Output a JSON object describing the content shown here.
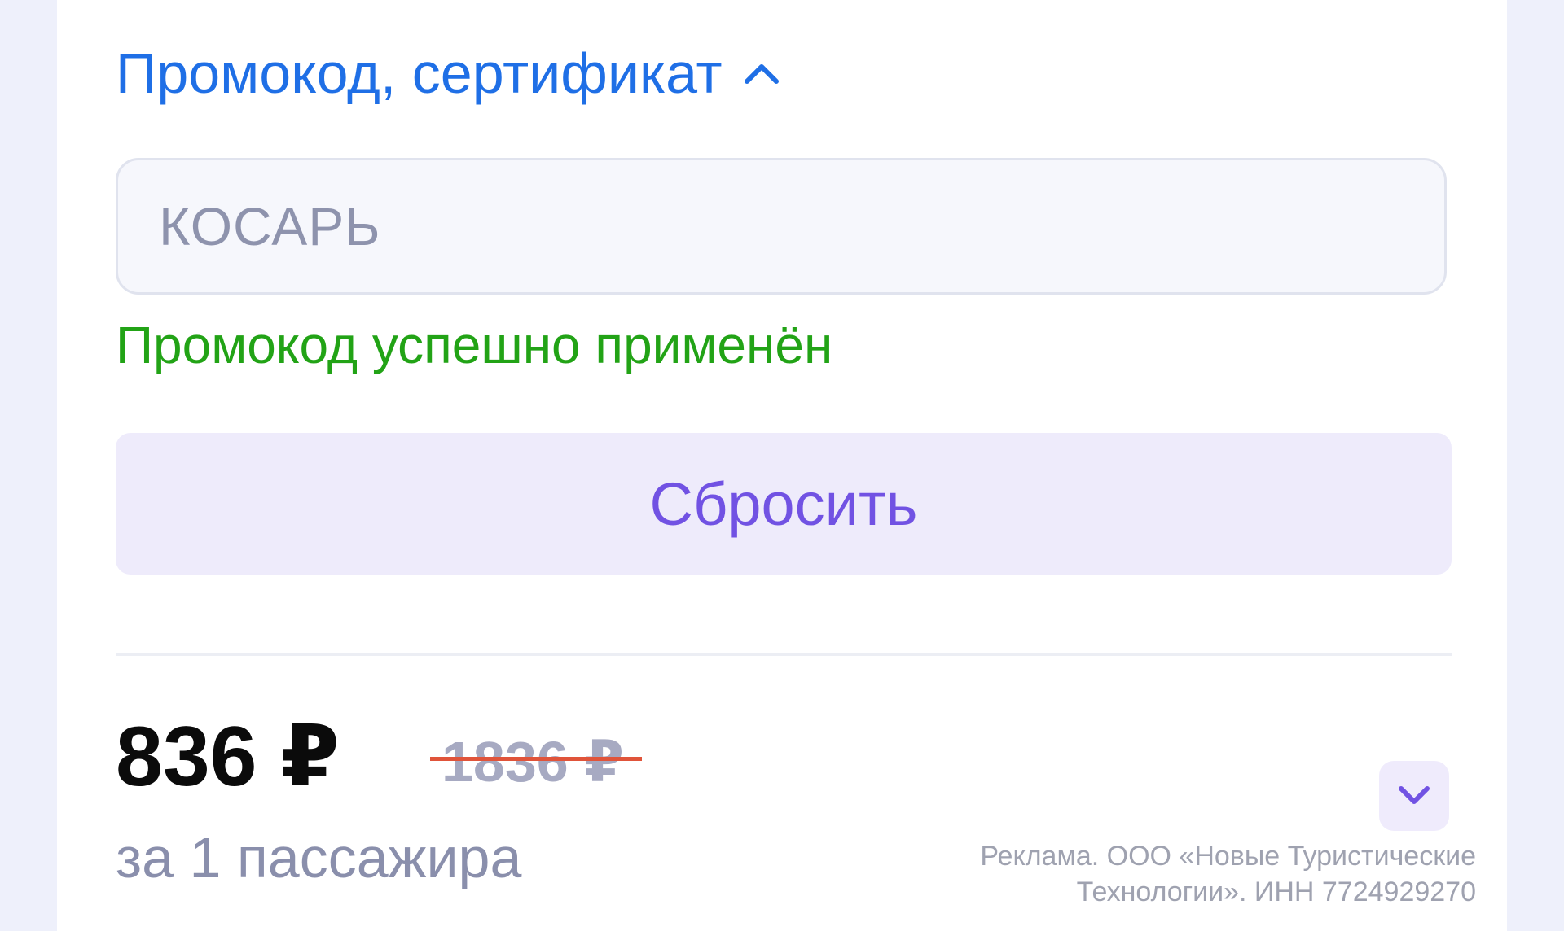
{
  "promo": {
    "toggle_label": "Промокод, сертификат",
    "toggle_icon": "chevron-up-icon",
    "input_value": "КОСАРЬ",
    "success_message": "Промокод успешно применён",
    "reset_label": "Сбросить"
  },
  "price": {
    "current": "836 ₽",
    "old": "1836 ₽",
    "per_label": "за 1 пассажира",
    "expand_icon": "chevron-down-icon"
  },
  "ad": {
    "line1": "Реклама. ООО «Новые Туристические",
    "line2": "Технологии». ИНН 7724929270"
  },
  "colors": {
    "link_blue": "#1f6fe6",
    "success_green": "#22a316",
    "accent_purple": "#7152e3",
    "strike_red": "#e0543a"
  }
}
